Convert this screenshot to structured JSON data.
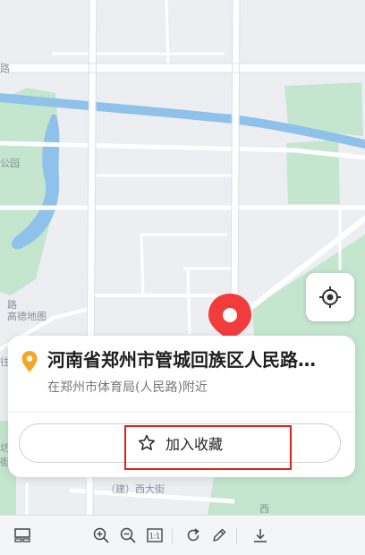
{
  "map": {
    "labels": {
      "gaode": "高德地图",
      "road_top": "路",
      "road_left": "路",
      "park": "公园",
      "street": "（建）西大街",
      "west": "西",
      "left_1": "往",
      "left_2": "坊",
      "left_3": "街"
    },
    "colors": {
      "background": "#eceef2",
      "water": "#8ec2ea",
      "park": "#c4e6cf",
      "road": "#ffffff",
      "marker": "#f23c3c"
    }
  },
  "locate_button": {
    "icon": "locate-icon"
  },
  "poi_card": {
    "address": "河南省郑州市管城回族区人民路…",
    "nearby": "在郑州市体育局(人民路)附近",
    "favorite_label": "加入收藏",
    "pin_color": "#f5a623"
  },
  "toolbar": {
    "items": [
      "thumbnail-icon",
      "zoom-in-icon",
      "zoom-out-icon",
      "actual-size-icon",
      "rotate-icon",
      "edit-icon",
      "download-icon"
    ],
    "actual_size_label": "1:1"
  }
}
